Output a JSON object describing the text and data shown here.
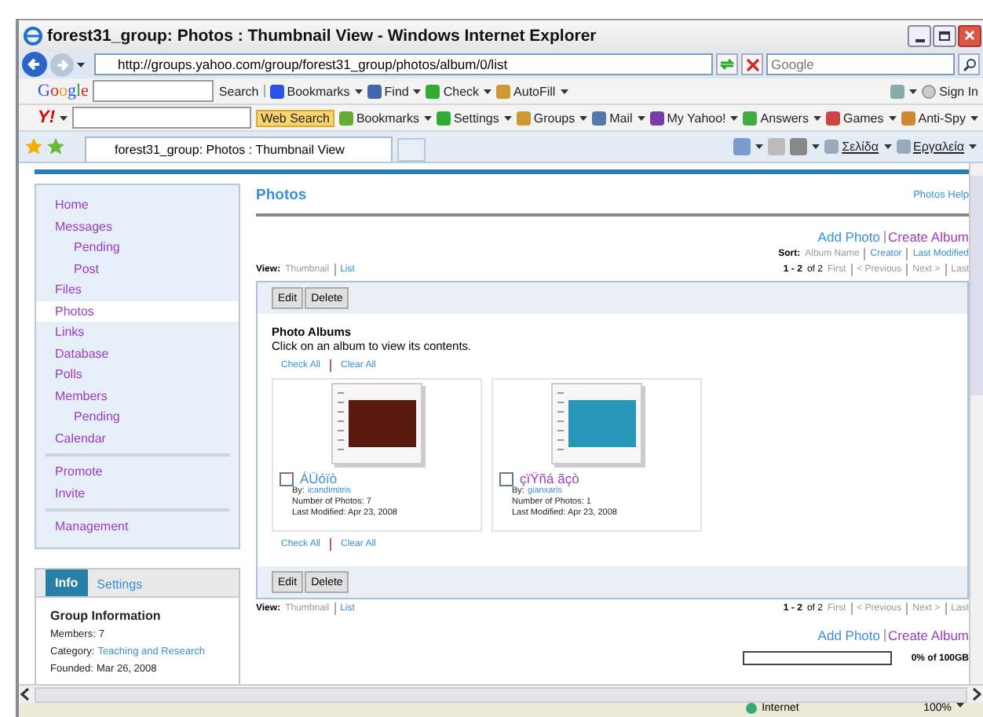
{
  "window": {
    "title": "forest31_group: Photos : Thumbnail View - Windows Internet Explorer"
  },
  "address_bar": {
    "url": "http://groups.yahoo.com/group/forest31_group/photos/album/0/list",
    "search_placeholder": "Google"
  },
  "google_toolbar": {
    "logo": "Google",
    "search_label": "Search",
    "items": [
      "Bookmarks",
      "Find",
      "Check",
      "AutoFill"
    ],
    "sign_in": "Sign In"
  },
  "yahoo_toolbar": {
    "logo": "Y!",
    "search_button": "Web Search",
    "items": [
      "Bookmarks",
      "Settings",
      "Groups",
      "Mail",
      "My Yahoo!",
      "Answers",
      "Games",
      "Anti-Spy"
    ]
  },
  "tab_bar": {
    "tab": "forest31_group: Photos : Thumbnail View",
    "commands": [
      "Σελίδα",
      "Εργαλεία"
    ]
  },
  "sidebar": {
    "sections": [
      [
        {
          "label": "Home",
          "selected": false
        },
        {
          "label": "Messages",
          "selected": false,
          "children": [
            {
              "label": "Pending",
              "selected": false
            },
            {
              "label": "Post",
              "selected": false
            }
          ]
        },
        {
          "label": "Files",
          "selected": false
        },
        {
          "label": "Photos",
          "selected": true
        },
        {
          "label": "Links",
          "selected": false
        },
        {
          "label": "Database",
          "selected": false
        },
        {
          "label": "Polls",
          "selected": false
        },
        {
          "label": "Members",
          "selected": false,
          "children": [
            {
              "label": "Pending",
              "selected": false
            }
          ]
        },
        {
          "label": "Calendar",
          "selected": false
        }
      ],
      [
        {
          "label": "Promote",
          "selected": false
        },
        {
          "label": "Invite",
          "selected": false
        }
      ],
      [
        {
          "label": "Management",
          "selected": false
        }
      ]
    ]
  },
  "info_panel": {
    "tabs": [
      {
        "label": "Info",
        "selected": true
      },
      {
        "label": "Settings",
        "selected": false
      }
    ],
    "heading": "Group Information",
    "fields": [
      {
        "label": "Members:",
        "value": "7",
        "link": false
      },
      {
        "label": "Category:",
        "value": "Teaching and Research",
        "link": true
      },
      {
        "label": "Founded:",
        "value": "Mar 26, 2008",
        "link": false
      }
    ]
  },
  "main": {
    "title": "Photos",
    "help": "Photos Help",
    "action_rows": [
      [
        {
          "label": "Add Photo",
          "visited": false
        },
        {
          "label": "Create Album",
          "visited": true
        }
      ],
      [
        {
          "label": "Add Photo",
          "visited": false
        },
        {
          "label": "Create Album",
          "visited": true
        }
      ]
    ],
    "sort": {
      "label": "Sort:",
      "options": [
        {
          "label": "Album Name",
          "selected": true
        },
        {
          "label": "Creator",
          "selected": false
        },
        {
          "label": "Last Modified",
          "selected": false
        }
      ]
    },
    "nav_bars": [
      {
        "view_label": "View:",
        "views": [
          {
            "label": "Thumbnail",
            "selected": true
          },
          {
            "label": "List",
            "selected": false
          }
        ],
        "count": "1 - 2",
        "total": "of 2",
        "pages": [
          "First",
          "< Previous",
          "Next >",
          "Last"
        ]
      },
      {
        "view_label": "View:",
        "views": [
          {
            "label": "Thumbnail",
            "selected": true
          },
          {
            "label": "List",
            "selected": false
          }
        ],
        "count": "1 - 2",
        "total": "of 2",
        "pages": [
          "First",
          "< Previous",
          "Next >",
          "Last"
        ]
      }
    ],
    "button_bars": [
      [
        "Edit",
        "Delete"
      ],
      [
        "Edit",
        "Delete"
      ]
    ],
    "albums_heading": "Photo Albums",
    "albums_hint": "Click on an album to view its contents.",
    "select_rows": [
      [
        "Check All",
        "Clear All"
      ],
      [
        "Check All",
        "Clear All"
      ]
    ],
    "albums": [
      {
        "name": "ÁÜóïò",
        "visited": false,
        "checked": false,
        "by_label": "By:",
        "by": "icandimitris",
        "count": "Number of Photos: 7",
        "modified": "Last Modified: Apr 23, 2008"
      },
      {
        "name": "çïŸñá ãçò",
        "visited": true,
        "checked": false,
        "by_label": "By:",
        "by": "gianxaris",
        "count": "Number of Photos: 1",
        "modified": "Last Modified: Apr 23, 2008"
      }
    ],
    "storage": {
      "level": 0,
      "reading": "0% of 100GB"
    }
  },
  "status_bar": {
    "zone": "Internet",
    "zoom": "100%"
  }
}
